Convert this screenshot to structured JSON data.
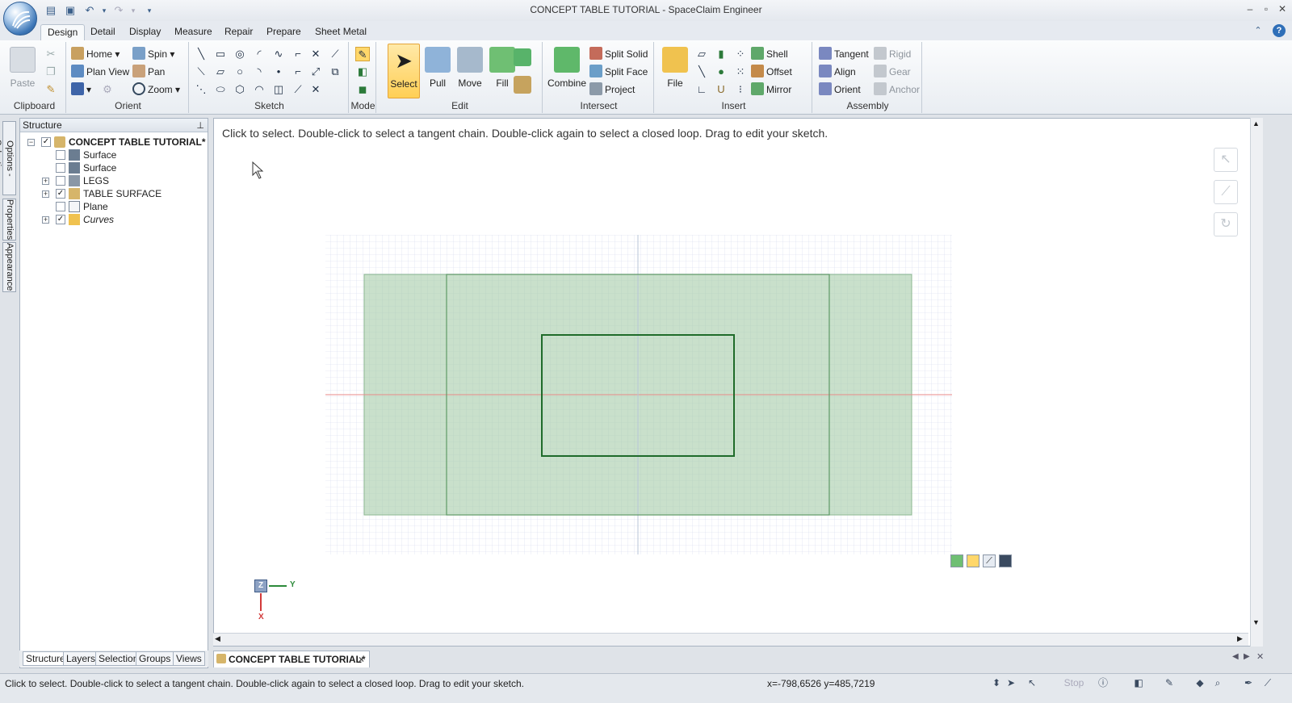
{
  "window": {
    "title": "CONCEPT TABLE TUTORIAL - SpaceClaim Engineer",
    "controls": [
      "minimize",
      "maximize",
      "close"
    ]
  },
  "quick_access": [
    "open-icon",
    "save-icon",
    "undo-icon",
    "redo-icon",
    "customize-icon"
  ],
  "ribbon": {
    "tabs": [
      {
        "label": "Design",
        "active": true
      },
      {
        "label": "Detail"
      },
      {
        "label": "Display"
      },
      {
        "label": "Measure"
      },
      {
        "label": "Repair"
      },
      {
        "label": "Prepare"
      },
      {
        "label": "Sheet Metal"
      }
    ],
    "groups": {
      "clipboard": {
        "label": "Clipboard",
        "paste": "Paste"
      },
      "orient": {
        "label": "Orient",
        "home": "Home",
        "spin": "Spin",
        "plan_view": "Plan View",
        "pan": "Pan",
        "zoom": "Zoom"
      },
      "sketch": {
        "label": "Sketch"
      },
      "mode": {
        "label": "Mode"
      },
      "edit": {
        "label": "Edit",
        "select": "Select",
        "pull": "Pull",
        "move": "Move",
        "fill": "Fill"
      },
      "intersect": {
        "label": "Intersect",
        "combine": "Combine",
        "split_solid": "Split Solid",
        "split_face": "Split Face",
        "project": "Project"
      },
      "insert": {
        "label": "Insert",
        "file": "File",
        "shell": "Shell",
        "offset": "Offset",
        "mirror": "Mirror"
      },
      "assembly": {
        "label": "Assembly",
        "tangent": "Tangent",
        "align": "Align",
        "orient": "Orient",
        "rigid": "Rigid",
        "gear": "Gear",
        "anchor": "Anchor"
      }
    }
  },
  "side_tabs": [
    "Options - Selection",
    "Properties",
    "Appearance"
  ],
  "structure": {
    "title": "Structure",
    "tree": [
      {
        "label": "CONCEPT TABLE TUTORIAL*",
        "checked": true,
        "expandable": "minus",
        "bold": true
      },
      {
        "label": "Surface",
        "checked": false
      },
      {
        "label": "Surface",
        "checked": false
      },
      {
        "label": "LEGS",
        "checked": false,
        "expandable": "plus"
      },
      {
        "label": "TABLE SURFACE",
        "checked": true,
        "expandable": "plus"
      },
      {
        "label": "Plane",
        "checked": false
      },
      {
        "label": "Curves",
        "checked": true,
        "expandable": "plus",
        "italic": true
      }
    ],
    "bottom_tabs": [
      "Structure",
      "Layers",
      "Selection",
      "Groups",
      "Views"
    ]
  },
  "viewport": {
    "hint": "Click to select. Double-click to select a tangent chain. Double-click again to select a closed loop. Drag to edit your sketch.",
    "triad": {
      "z": "Z",
      "y": "Y",
      "x": "X"
    }
  },
  "document_tab": "CONCEPT TABLE TUTORIAL*",
  "statusbar": {
    "text": "Click to select. Double-click to select a tangent chain. Double-click again to select a closed loop. Drag to edit your sketch.",
    "coords": "x=-798,6526  y=485,7219",
    "stop": "Stop"
  },
  "colors": {
    "sketch_fill": "#9cc6a0",
    "sketch_line": "#1f6b2a",
    "grid_minor": "#d3d8ec",
    "axis_red": "#e88a8a",
    "accent": "#2f6fb8"
  }
}
